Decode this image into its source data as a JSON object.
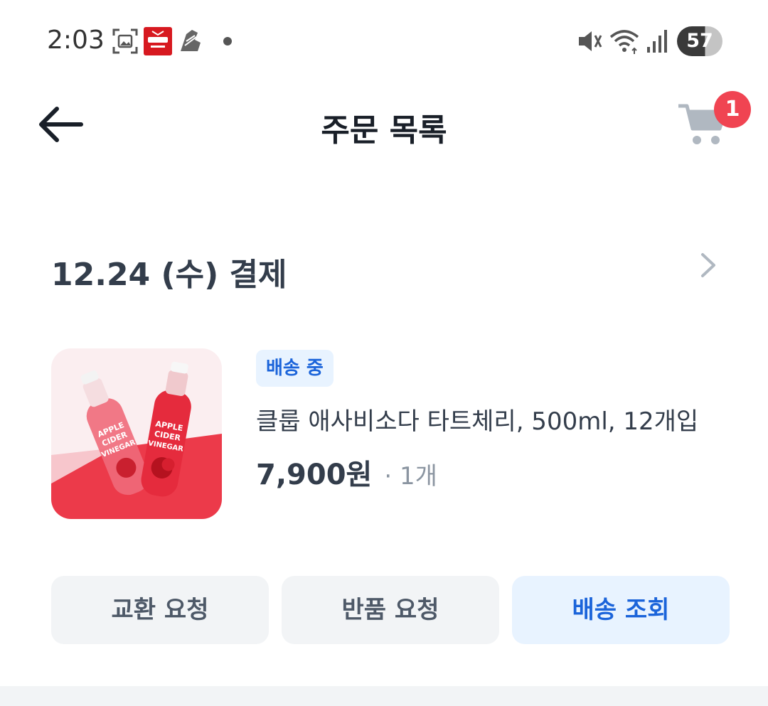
{
  "status_bar": {
    "time": "2:03",
    "battery": "57",
    "icons": [
      "screenshot-icon",
      "app-notification-icon",
      "shoe-icon",
      "dot-icon",
      "mute-icon",
      "wifi-icon",
      "signal-icon",
      "battery-icon"
    ]
  },
  "header": {
    "title": "주문 목록",
    "back_icon": "back-arrow-icon",
    "cart_icon": "cart-icon",
    "cart_badge": "1"
  },
  "order": {
    "date_label": "12.24 (수) 결제",
    "status": "배송 중",
    "product_name": "클룹 애사비소다 타트체리, 500ml, 12개입",
    "price": "7,900원",
    "quantity": "· 1개"
  },
  "actions": {
    "exchange": "교환 요청",
    "return": "반품 요청",
    "track": "배송 조회"
  },
  "colors": {
    "accent": "#1b64da",
    "accent_bg": "#e8f3ff",
    "badge": "#f04452",
    "button_bg": "#f2f4f6"
  }
}
